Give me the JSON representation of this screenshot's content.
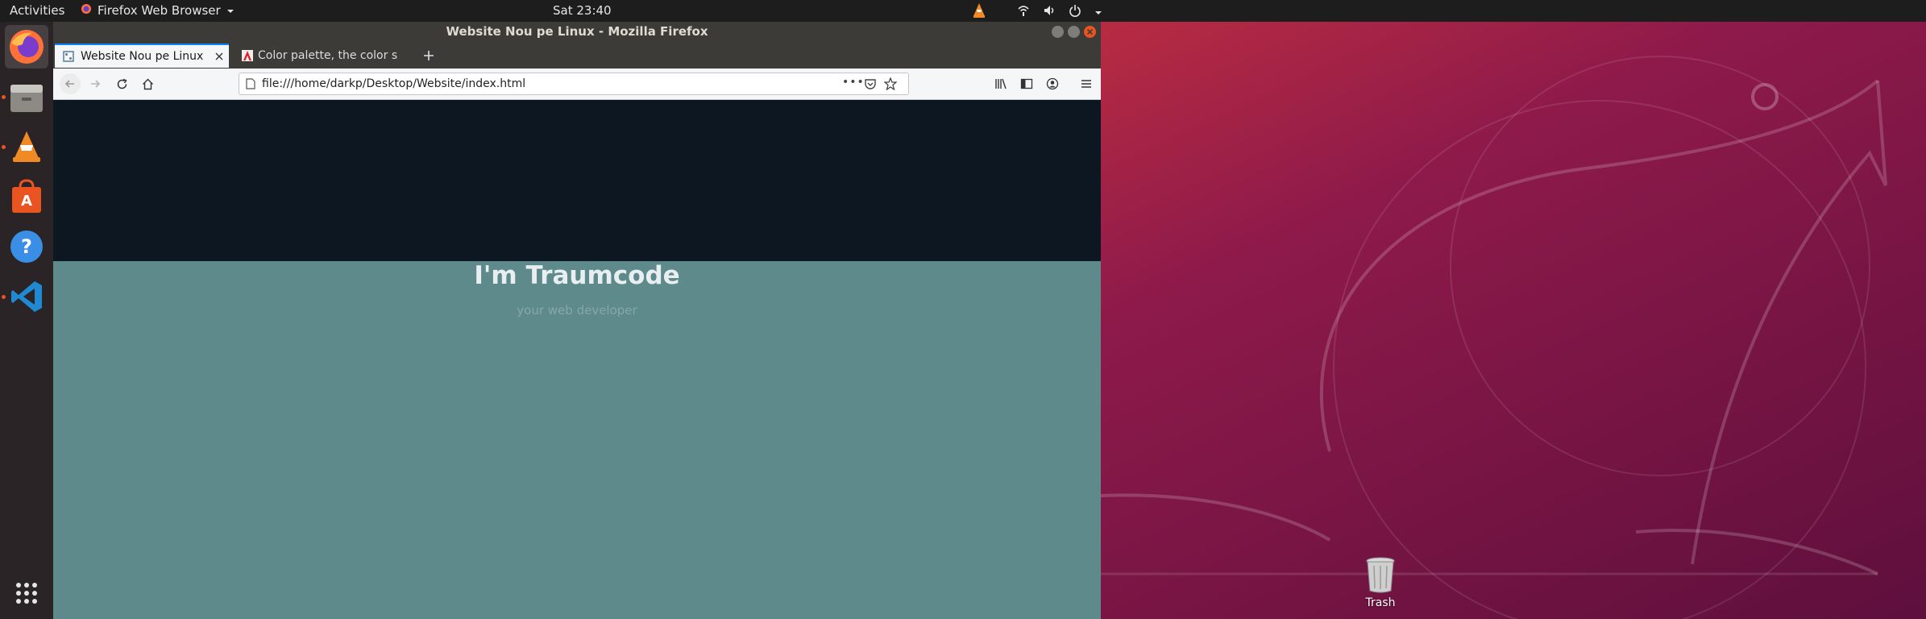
{
  "topbar": {
    "activities": "Activities",
    "app_menu": "Firefox Web Browser",
    "clock": "Sat 23:40"
  },
  "dock": {
    "items": [
      "firefox-icon",
      "files-icon",
      "vlc-icon",
      "software-center-icon",
      "help-icon",
      "vscode-icon"
    ],
    "show_apps": "grid-icon"
  },
  "window": {
    "title": "Website Nou pe Linux - Mozilla Firefox",
    "tabs": [
      {
        "label": "Website Nou pe Linux",
        "selected": true
      },
      {
        "label": "Color palette, the color s",
        "selected": false
      }
    ],
    "url": "file:///home/darkp/Desktop/Website/index.html"
  },
  "page": {
    "headline": "I'm Traumcode",
    "subline": "your web developer"
  },
  "desktop": {
    "trash_label": "Trash"
  },
  "colors": {
    "accent": "#e95420",
    "hero_dark": "#0d1722",
    "hero_teal": "#5f8a8c",
    "tab_highlight": "#0a84ff"
  }
}
